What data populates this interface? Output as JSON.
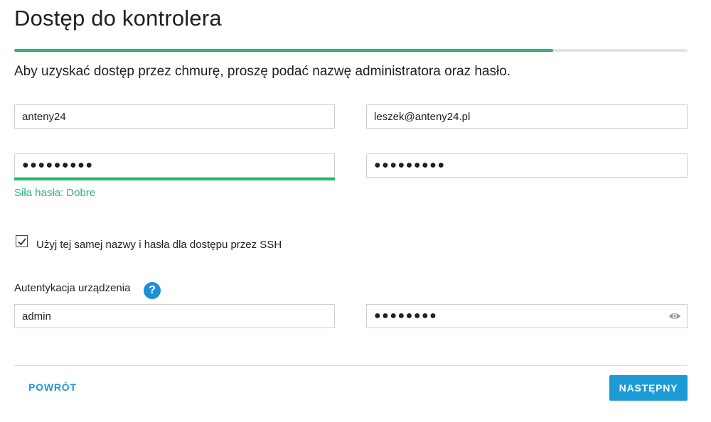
{
  "page": {
    "title": "Dostęp do kontrolera",
    "subtitle": "Aby uzyskać dostęp przez chmurę, proszę podać nazwę administratora oraz hasło.",
    "progress_fraction": 0.8
  },
  "cloud": {
    "username_value": "anteny24",
    "email_value": "leszek@anteny24.pl",
    "password_value": "●●●●●●●●●",
    "password_confirm_value": "●●●●●●●●●",
    "strength_text": "Siła hasła: Dobre"
  },
  "ssh": {
    "checkbox_label": "Użyj tej samej nazwy i hasła dla dostępu przez SSH",
    "checked": true
  },
  "device_auth": {
    "label": "Autentykacja urządzenia",
    "help_icon": "?",
    "username_value": "admin",
    "password_value": "●●●●●●●●"
  },
  "footer": {
    "back_label": "POWRÓT",
    "next_label": "NASTĘPNY"
  },
  "colors": {
    "accent_green": "#2bb673",
    "accent_blue": "#1c9bd7"
  },
  "icons": {
    "checkbox": "checkmark-icon",
    "help": "question-circle-icon",
    "reveal": "eye-icon"
  }
}
